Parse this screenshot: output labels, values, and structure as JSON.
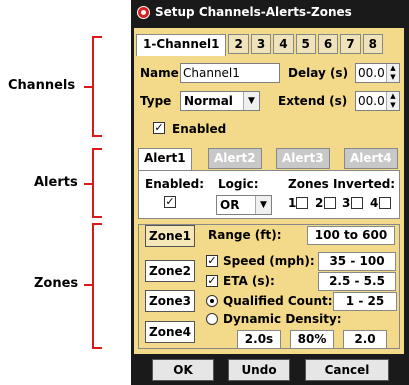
{
  "annotations": {
    "channels_label": "Channels",
    "alerts_label": "Alerts",
    "zones_label": "Zones"
  },
  "window": {
    "title": "Setup Channels-Alerts-Zones"
  },
  "channel_tabs": [
    "1-Channel1",
    "2",
    "3",
    "4",
    "5",
    "6",
    "7",
    "8"
  ],
  "channel": {
    "name_label": "Name",
    "name_value": "Channel1",
    "delay_label": "Delay (s)",
    "delay_value": "00.0",
    "type_label": "Type",
    "type_value": "Normal",
    "extend_label": "Extend (s)",
    "extend_value": "00.0",
    "enabled_label": "Enabled",
    "enabled_checked": true
  },
  "alert_tabs": [
    "Alert1",
    "Alert2",
    "Alert3",
    "Alert4"
  ],
  "alert": {
    "enabled_label": "Enabled:",
    "logic_label": "Logic:",
    "logic_value": "OR",
    "zones_inverted_label": "Zones Inverted:",
    "zones_inverted": [
      "1",
      "2",
      "3",
      "4"
    ]
  },
  "zone_buttons": [
    "Zone1",
    "Zone2",
    "Zone3",
    "Zone4"
  ],
  "zone": {
    "range_label": "Range (ft):",
    "range_value": "100 to 600",
    "speed_label": "Speed (mph):",
    "speed_value": "35 - 100",
    "eta_label": "ETA (s):",
    "eta_value": "2.5 - 5.5",
    "qualified_label": "Qualified Count:",
    "qualified_value": "1 - 25",
    "dynamic_label": "Dynamic Density:",
    "density_values": [
      "2.0s",
      "80%",
      "2.0"
    ]
  },
  "buttons": {
    "ok": "OK",
    "undo": "Undo",
    "cancel": "Cancel"
  },
  "colors": {
    "annotation_red": "#d91a1a",
    "panel_tan": "#f3d98a",
    "title_bar": "#1a1a1a"
  }
}
